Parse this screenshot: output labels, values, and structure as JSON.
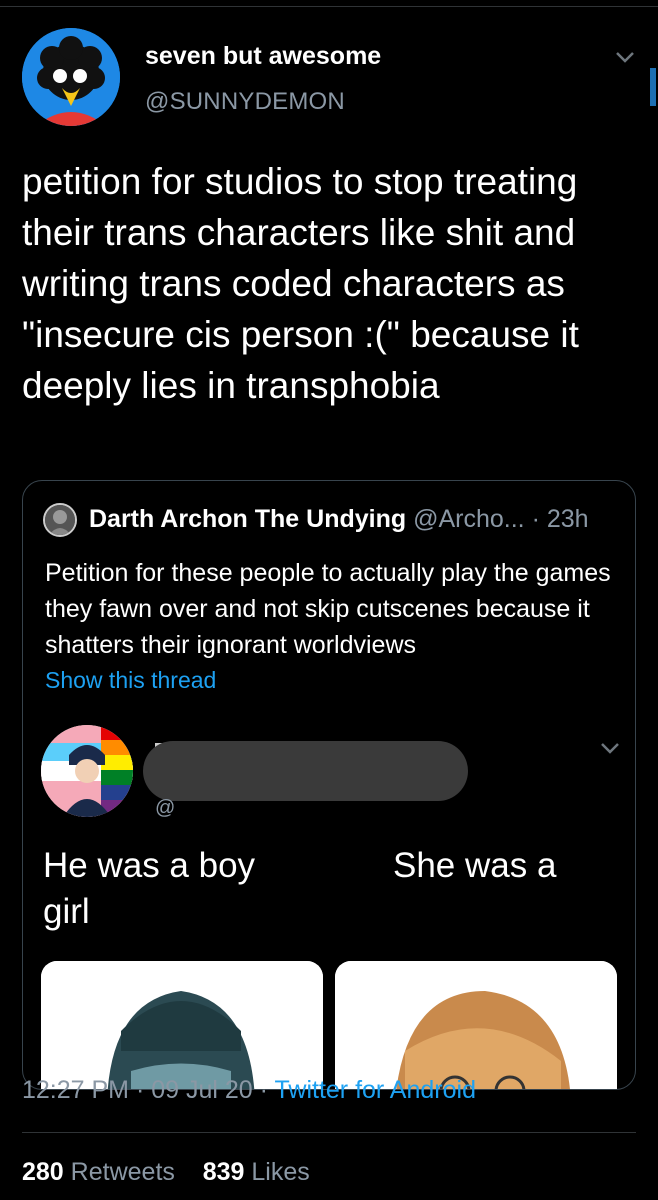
{
  "tweet": {
    "author_name": "seven but awesome",
    "author_handle": "@SUNNYDEMON",
    "text": "petition for studios to stop treating their trans characters like shit and writing trans coded characters as \"insecure cis person :(\" because it deeply lies in transphobia",
    "time": "12:27 PM",
    "date": "09 Jul 20",
    "source": "Twitter for Android",
    "retweets_count": "280",
    "retweets_label": "Retweets",
    "likes_count": "839",
    "likes_label": "Likes"
  },
  "quote": {
    "author_name": "Darth Archon The Undying",
    "author_handle": "@Archo...",
    "age": "23h",
    "text": "Petition for these people to actually play the games they fawn over and not skip cutscenes because it shatters their ignorant worldviews",
    "show_thread": "Show this thread",
    "inner": {
      "handle_fragment": "@",
      "text_left": "He was a boy girl",
      "text_right": "She was a"
    }
  },
  "colors": {
    "background": "#000000",
    "text_primary": "#ffffff",
    "text_secondary": "#8b98a5",
    "link": "#1da1f2",
    "border": "#38444d"
  },
  "icons": [
    "avatar",
    "chevron-down-icon",
    "chevron-down-icon"
  ]
}
